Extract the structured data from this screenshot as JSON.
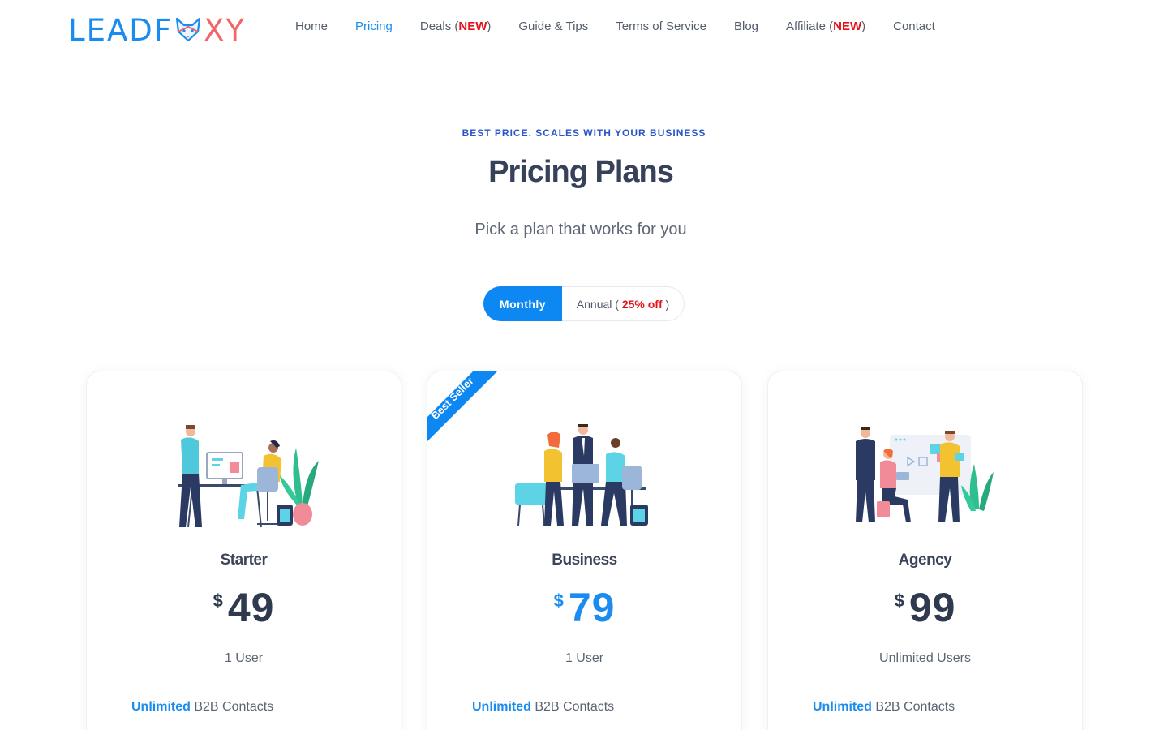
{
  "brand": {
    "logo_left": "LEADF",
    "logo_right": "XY",
    "colors": {
      "primary": "#1a8cf0",
      "accent": "#f26467",
      "new_badge": "#e3131b"
    }
  },
  "nav": {
    "items": [
      {
        "label": "Home"
      },
      {
        "label": "Pricing",
        "active": true
      },
      {
        "label": "Deals (",
        "badge": "NEW",
        "suffix": ")"
      },
      {
        "label": "Guide & Tips"
      },
      {
        "label": "Terms of Service"
      },
      {
        "label": "Blog"
      },
      {
        "label": "Affiliate (",
        "badge": "NEW",
        "suffix": ")"
      },
      {
        "label": "Contact"
      }
    ]
  },
  "hero": {
    "eyebrow": "BEST PRICE. SCALES WITH YOUR BUSINESS",
    "title": "Pricing Plans",
    "subtitle": "Pick a plan that works for you"
  },
  "billing_toggle": {
    "monthly_label": "Monthly",
    "annual_prefix": "Annual ( ",
    "annual_discount": "25% off",
    "annual_suffix": " )",
    "selected": "Monthly"
  },
  "plans": [
    {
      "name": "Starter",
      "currency": "$",
      "price": "49",
      "users": "1 User",
      "feature_highlight": "Unlimited",
      "feature_text": " B2B Contacts",
      "illustration": "team-desk-illustration-icon"
    },
    {
      "name": "Business",
      "currency": "$",
      "price": "79",
      "users": "1 User",
      "feature_highlight": "Unlimited",
      "feature_text": " B2B Contacts",
      "ribbon": "Best Seller",
      "illustration": "business-team-illustration-icon"
    },
    {
      "name": "Agency",
      "currency": "$",
      "price": "99",
      "users": "Unlimited Users",
      "feature_highlight": "Unlimited",
      "feature_text": " B2B Contacts",
      "illustration": "agency-team-illustration-icon"
    }
  ]
}
